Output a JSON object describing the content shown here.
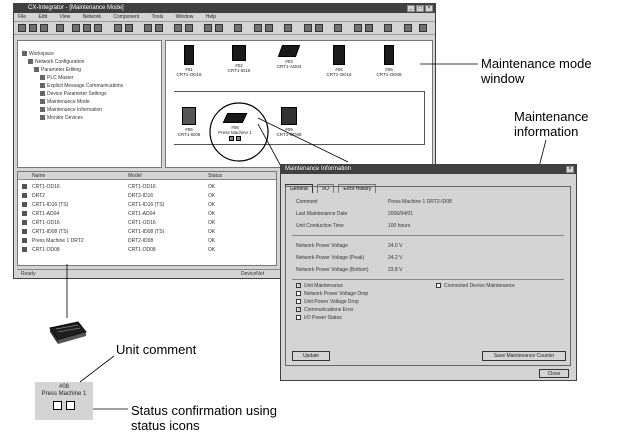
{
  "main_window": {
    "title": "CX-Integrator - [Maintenance Mode]",
    "menu": [
      "File",
      "Edit",
      "View",
      "Network",
      "Component",
      "Tools",
      "Window",
      "Help"
    ],
    "status_bar": {
      "left": "Ready",
      "right": "DeviceNet"
    }
  },
  "tree": {
    "items": [
      "Workspace",
      "Network Configuration",
      "Parameter Editing",
      "PLC Master",
      "Explicit Message Communications",
      "Device Parameter Settings",
      "Maintenance Mode",
      "Maintenance Information",
      "Monitor Devices"
    ]
  },
  "units_top": [
    {
      "address": "#01",
      "name": "CRT1-OD16"
    },
    {
      "address": "#02",
      "name": "CRT1-ID16"
    },
    {
      "address": "#03",
      "name": "CRT1-AD04"
    },
    {
      "address": "#04",
      "name": "CRT1-OD16"
    },
    {
      "address": "#05",
      "name": "CRT1-OD08"
    }
  ],
  "units_bottom": [
    {
      "address": "#06",
      "name": "CRT1-ID08"
    },
    {
      "address": "#08",
      "name": "Press Machine 1"
    },
    {
      "address": "#09",
      "name": "CRT1-OD08"
    }
  ],
  "list": {
    "headers": [
      "Name",
      "Model",
      "Status"
    ],
    "rows": [
      [
        "CRT1-OD16",
        "CRT1-OD16",
        "OK"
      ],
      [
        "DRT2",
        "DRT2-ID16",
        "OK"
      ],
      [
        "CRT1-ID16 (TS)",
        "CRT1-ID16 (TS)",
        "OK"
      ],
      [
        "CRT1-AD04",
        "CRT1-AD04",
        "OK"
      ],
      [
        "CRT1-OD16",
        "CRT1-OD16",
        "OK"
      ],
      [
        "CRT1-ID08 (TS)",
        "CRT1-ID08 (TS)",
        "OK"
      ],
      [
        "Press Machine 1 DRT2",
        "DRT2-ID08",
        "OK"
      ],
      [
        "CRT1-OD08",
        "CRT1-OD08",
        "OK"
      ]
    ]
  },
  "dialog": {
    "title": "Maintenance Information",
    "tabs": [
      "General",
      "I/O",
      "Error History"
    ],
    "fields": [
      {
        "label": "Comment",
        "value": "Press Machine 1 DRT2-ID08"
      },
      {
        "label": "Last Maintenance Date",
        "value": "2006/04/01"
      },
      {
        "label": "Unit Conduction Time",
        "value": "100 hours"
      },
      {
        "label": "Network Power Voltage",
        "value": "24.0 V"
      },
      {
        "label": "Network Power Voltage (Peak)",
        "value": "24.2 V"
      },
      {
        "label": "Network Power Voltage (Bottom)",
        "value": "23.8 V"
      }
    ],
    "checks": [
      {
        "label": "Unit Maintenance",
        "checked": true
      },
      {
        "label": "Network Power Voltage Drop",
        "checked": false
      },
      {
        "label": "Unit Power Voltage Drop",
        "checked": false
      },
      {
        "label": "Communications Error",
        "checked": true
      },
      {
        "label": "I/O Power Status",
        "checked": false
      }
    ],
    "check_right": "Connected Device Maintenance",
    "button_left": "Update",
    "button_right": "Save Maintenance Counter",
    "button_close": "Close"
  },
  "callouts": {
    "maintenance_mode": "Maintenance mode\nwindow",
    "maintenance_info": "Maintenance\ninformation",
    "unit_comment": "Unit comment",
    "status_confirmation": "Status confirmation using\nstatus icons"
  },
  "zoom_unit": {
    "address": "#08",
    "name": "Press Machine 1"
  }
}
